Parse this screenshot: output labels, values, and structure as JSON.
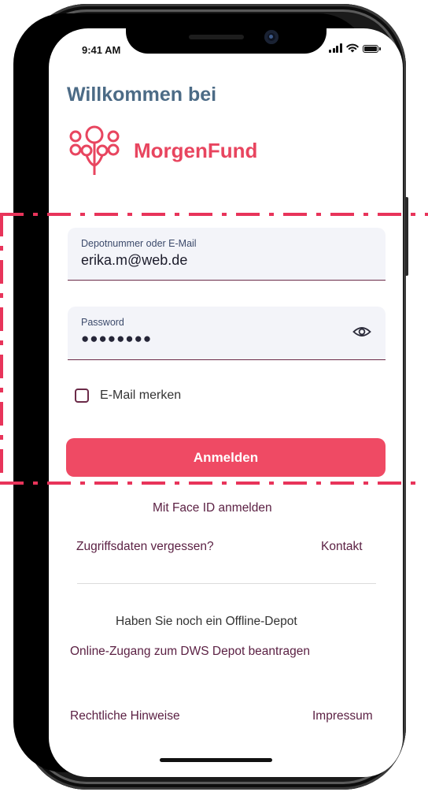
{
  "status_bar": {
    "time": "9:41 AM",
    "signal_icon": "cellular-signal-icon",
    "wifi_icon": "wifi-icon",
    "battery_icon": "battery-icon"
  },
  "header": {
    "welcome": "Willkommen bei",
    "brand_name": "MorgenFund",
    "logo_icon": "morgenfund-flower-logo-icon",
    "brand_color": "#e8455f"
  },
  "form": {
    "login_field": {
      "label": "Depotnummer oder E-Mail",
      "value": "erika.m@web.de"
    },
    "password_field": {
      "label": "Password",
      "value": "●●●●●●●●",
      "toggle_icon": "eye-icon"
    },
    "remember": {
      "label": "E-Mail merken",
      "checked": false
    },
    "submit_label": "Anmelden",
    "accent_color": "#ef4a64"
  },
  "links": {
    "face_id": "Mit Face ID anmelden",
    "forgot": "Zugriffsdaten vergessen?",
    "contact": "Kontakt",
    "offline_question": "Haben Sie noch ein Offline-Depot",
    "apply_online": "Online-Zugang zum DWS Depot beantragen",
    "legal": "Rechtliche Hinweise",
    "imprint": "Impressum"
  },
  "highlight": {
    "color": "#e8345a",
    "style": "dash-dot"
  }
}
